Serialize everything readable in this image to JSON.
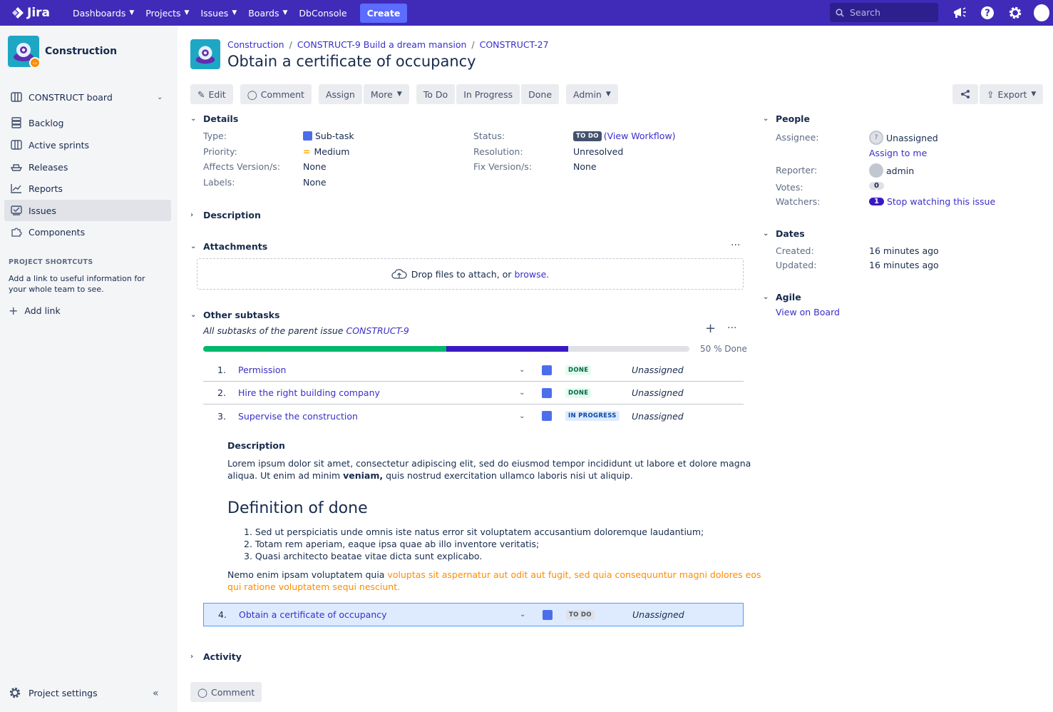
{
  "topnav": {
    "logo": "Jira",
    "menus": [
      "Dashboards",
      "Projects",
      "Issues",
      "Boards"
    ],
    "dbconsole": "DbConsole",
    "create": "Create",
    "search_placeholder": "Search"
  },
  "sidebar": {
    "project_name": "Construction",
    "board": "CONSTRUCT board",
    "items": [
      "Backlog",
      "Active sprints",
      "Releases",
      "Reports",
      "Issues",
      "Components"
    ],
    "active_item": "Issues",
    "shortcuts_heading": "PROJECT SHORTCUTS",
    "shortcuts_text": "Add a link to useful information for your whole team to see.",
    "add_link": "Add link",
    "project_settings": "Project settings"
  },
  "issue": {
    "breadcrumbs": [
      "Construction",
      "CONSTRUCT-9 Build a dream mansion",
      "CONSTRUCT-27"
    ],
    "title": "Obtain a certificate of occupancy"
  },
  "toolbar": {
    "edit": "Edit",
    "comment": "Comment",
    "assign": "Assign",
    "more": "More",
    "todo": "To Do",
    "inprogress": "In Progress",
    "done": "Done",
    "admin": "Admin",
    "export": "Export"
  },
  "details": {
    "heading": "Details",
    "type_label": "Type:",
    "type_value": "Sub-task",
    "priority_label": "Priority:",
    "priority_value": "Medium",
    "affects_label": "Affects Version/s:",
    "affects_value": "None",
    "labels_label": "Labels:",
    "labels_value": "None",
    "status_label": "Status:",
    "status_value": "TO DO",
    "view_workflow": "(View Workflow)",
    "resolution_label": "Resolution:",
    "resolution_value": "Unresolved",
    "fix_label": "Fix Version/s:",
    "fix_value": "None"
  },
  "description_heading": "Description",
  "attachments": {
    "heading": "Attachments",
    "drop_text": "Drop files to attach, or",
    "browse": "browse."
  },
  "subtasks": {
    "heading": "Other subtasks",
    "caption_prefix": "All subtasks of the parent issue",
    "caption_link": "CONSTRUCT-9",
    "progress_done_fraction": 0.5,
    "progress_inprogress_fraction": 0.25,
    "progress_label": "50 % Done",
    "rows": [
      {
        "num": "1.",
        "summary": "Permission",
        "status": "DONE",
        "assignee": "Unassigned"
      },
      {
        "num": "2.",
        "summary": "Hire the right building company",
        "status": "DONE",
        "assignee": "Unassigned"
      },
      {
        "num": "3.",
        "summary": "Supervise the construction",
        "status": "IN PROGRESS",
        "assignee": "Unassigned"
      },
      {
        "num": "4.",
        "summary": "Obtain a certificate of occupancy",
        "status": "TO DO",
        "assignee": "Unassigned"
      }
    ],
    "expanded": {
      "desc_heading": "Description",
      "lorem_1": "Lorem ipsum dolor sit amet, consectetur adipiscing elit, sed do eiusmod tempor incididunt ut labore et dolore magna",
      "lorem_2a": "aliqua. Ut enim ad minim",
      "lorem_2b": "veniam,",
      "lorem_2c": "quis nostrud exercitation ullamco laboris nisi ut aliquip.",
      "dod_heading": "Definition of done",
      "dod_items": [
        "1. Sed ut perspiciatis unde omnis iste natus error sit voluptatem accusantium doloremque laudantium;",
        "2. Totam rem aperiam, eaque ipsa quae ab illo inventore veritatis;",
        "3. Quasi architecto beatae vitae dicta sunt explicabo."
      ],
      "nemo_plain": "Nemo enim ipsam voluptatem quia",
      "nemo_orange_1": "voluptas sit aspernatur aut odit aut fugit, sed quia consequuntur magni dolores eos",
      "nemo_orange_2": "qui ratione voluptatem sequi nesciunt."
    }
  },
  "activity_heading": "Activity",
  "comment_button": "Comment",
  "people": {
    "heading": "People",
    "assignee_label": "Assignee:",
    "assignee_value": "Unassigned",
    "assign_to_me": "Assign to me",
    "reporter_label": "Reporter:",
    "reporter_value": "admin",
    "votes_label": "Votes:",
    "votes_value": "0",
    "watchers_label": "Watchers:",
    "watchers_count": "1",
    "stop_watching": "Stop watching this issue"
  },
  "dates": {
    "heading": "Dates",
    "created_label": "Created:",
    "created_value": "16 minutes ago",
    "updated_label": "Updated:",
    "updated_value": "16 minutes ago"
  },
  "agile": {
    "heading": "Agile",
    "view_on_board": "View on Board"
  },
  "colors": {
    "topnav": "#3f2bb8",
    "link": "#3a2fc9",
    "progress_done": "#00b86b",
    "progress_inprogress": "#3a19c4"
  }
}
